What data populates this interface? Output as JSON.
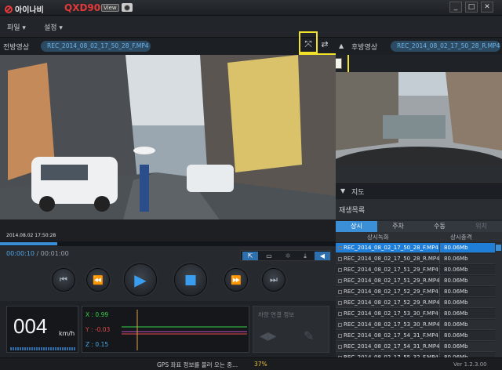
{
  "window": {
    "logo_text": "아이나비",
    "model": "QXD900",
    "view_badge": "View",
    "minimize": "_",
    "maximize": "□",
    "close": "✕"
  },
  "menu": {
    "file": "파일 ▾",
    "settings": "설정 ▾"
  },
  "front": {
    "label": "전방영상",
    "file": "REC_2014_08_02_17_50_28_F.MP4",
    "fullscreen_tooltip": "전체 화면",
    "overlay_text": "2014.08.02 17:50:28"
  },
  "rear": {
    "label": "후방영상",
    "file": "REC_2014_08_02_17_50_28_R.MP4"
  },
  "map_section": {
    "label": "지도"
  },
  "playlist": {
    "label": "재생목록",
    "tabs": [
      "상시",
      "주차",
      "수동",
      "위치"
    ],
    "columns": [
      "상시녹화",
      "상시충격"
    ],
    "rows": [
      {
        "name": "REC_2014_08_02_17_50_28_F.MP4",
        "size": "80.06Mb"
      },
      {
        "name": "REC_2014_08_02_17_50_28_R.MP4",
        "size": "80.06Mb"
      },
      {
        "name": "REC_2014_08_02_17_51_29_F.MP4",
        "size": "80.06Mb"
      },
      {
        "name": "REC_2014_08_02_17_51_29_R.MP4",
        "size": "80.06Mb"
      },
      {
        "name": "REC_2014_08_02_17_52_29_F.MP4",
        "size": "80.06Mb"
      },
      {
        "name": "REC_2014_08_02_17_52_29_R.MP4",
        "size": "80.06Mb"
      },
      {
        "name": "REC_2014_08_02_17_53_30_F.MP4",
        "size": "80.06Mb"
      },
      {
        "name": "REC_2014_08_02_17_53_30_R.MP4",
        "size": "80.06Mb"
      },
      {
        "name": "REC_2014_08_02_17_54_31_F.MP4",
        "size": "80.06Mb"
      },
      {
        "name": "REC_2014_08_02_17_54_31_R.MP4",
        "size": "80.06Mb"
      },
      {
        "name": "REC_2014_08_02_17_55_32_F.MP4",
        "size": "80.06Mb"
      }
    ]
  },
  "playback": {
    "time_current": "00:00:10",
    "time_sep": "/",
    "time_total": "00:01:00",
    "progress": 0.17
  },
  "speed": {
    "value": "004",
    "unit": "km/h"
  },
  "gsensor": {
    "x": "X : 0.99",
    "y": "Y : -0.03",
    "z": "Z : 0.15",
    "colors": {
      "x": "#3bd14b",
      "y": "#e24a4a",
      "z": "#4aa8e8"
    }
  },
  "vehicle_info": {
    "label": "차량 연결 정보"
  },
  "status": {
    "gps_text": "GPS 좌표 정보를 불러 오는 중...",
    "gps_percent": "37%",
    "version": "Ver 1.2.3.00"
  },
  "colors": {
    "accent": "#3a8fd6",
    "selected_row": "#1f7fd8"
  }
}
